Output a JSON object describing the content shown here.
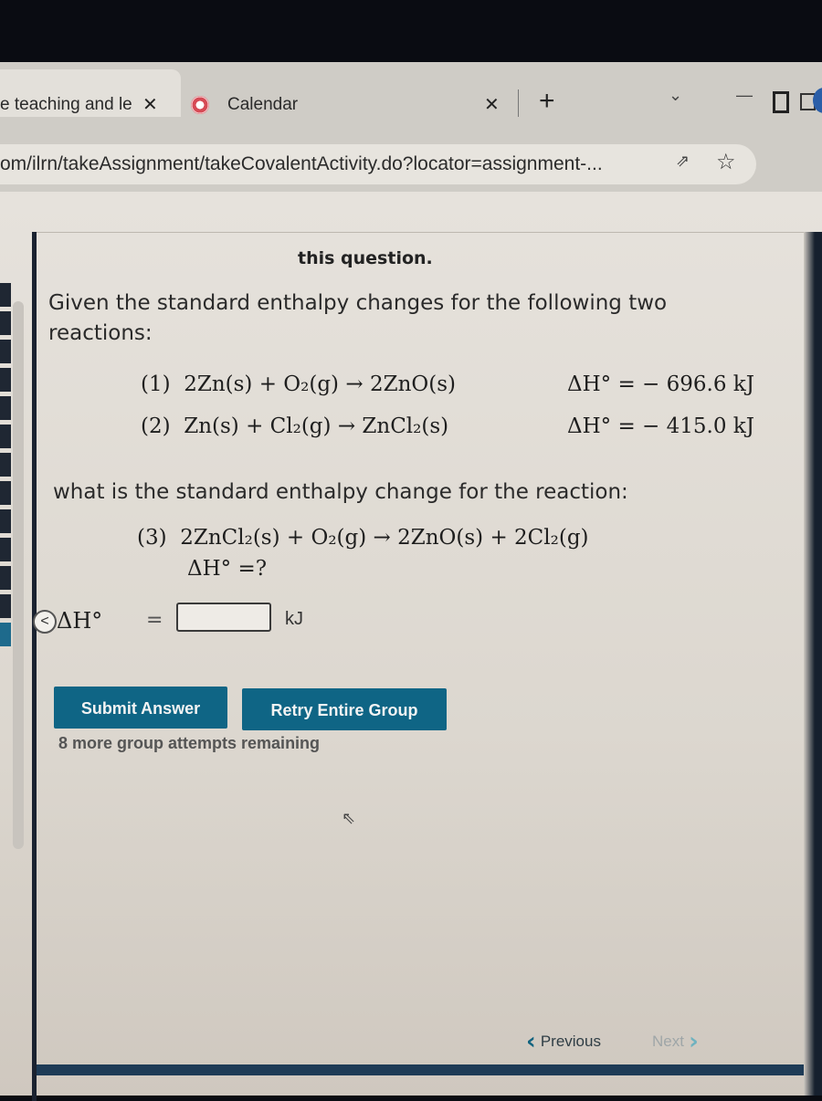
{
  "browser": {
    "tabs": [
      {
        "title": "e teaching and le",
        "active": true,
        "close_label": "✕"
      },
      {
        "title": "Calendar",
        "active": false,
        "icon": "calendar-icon",
        "close_label": "✕"
      }
    ],
    "new_tab_label": "+",
    "url": "om/ilrn/takeAssignment/takeCovalentActivity.do?locator=assignment-...",
    "controls": {
      "dropdown": "⌄",
      "minimize": "—"
    },
    "icons": {
      "share": "share-icon",
      "bookmark": "star-icon",
      "sidepanel": "sidepanel-icon",
      "profile": "profile-icon"
    }
  },
  "question": {
    "header_fragment": "this question.",
    "intro": "Given the standard enthalpy changes for the following two reactions:",
    "reactions": [
      {
        "number": "(1)",
        "lhs": "2Zn(s) + O₂(g)",
        "arrow": "→",
        "rhs": "2ZnO(s)",
        "delta_h": "ΔH° = − 696.6 kJ"
      },
      {
        "number": "(2)",
        "lhs": "Zn(s) + Cl₂(g)",
        "arrow": "→",
        "rhs": "ZnCl₂(s)",
        "delta_h": "ΔH° = − 415.0 kJ"
      }
    ],
    "prompt": "what is the standard enthalpy change for the reaction:",
    "target_reaction": {
      "number": "(3)",
      "lhs": "2ZnCl₂(s) + O₂(g)",
      "arrow": "→",
      "rhs": "2ZnO(s) + 2Cl₂(g)",
      "delta_h": "ΔH° =?"
    }
  },
  "answer": {
    "collapse_label": "<",
    "label": "ΔH°",
    "equals": "=",
    "value": "",
    "unit": "kJ"
  },
  "actions": {
    "submit_label": "Submit Answer",
    "retry_label": "Retry Entire Group",
    "attempts_text": "8 more group attempts remaining"
  },
  "navigation": {
    "previous_label": "Previous",
    "next_label": "Next",
    "next_disabled": true
  },
  "colors": {
    "button": "#0f6585",
    "nav_active": "#12637f",
    "nav_disabled": "#6fb2bf"
  }
}
